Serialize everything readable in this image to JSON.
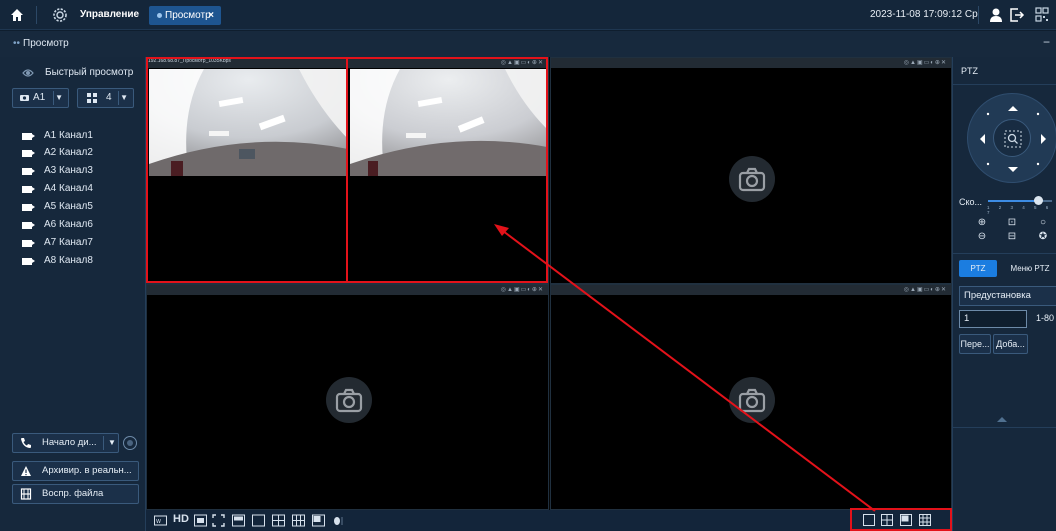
{
  "topbar": {
    "title": "Управление",
    "tab_label": "Просмотр",
    "tab_close": "×",
    "datetime": "2023-11-08 17:09:12 Ср"
  },
  "subbar": {
    "title": "Просмотр",
    "minimize": "−"
  },
  "left_panel": {
    "quick_view": "Быстрый просмотр",
    "stream_select": "A1",
    "split_select": "4",
    "channels": [
      "A1 Канал1",
      "A2 Канал2",
      "A3 Канал3",
      "A4 Канал4",
      "A5 Канал5",
      "A6 Канал6",
      "A7 Канал7",
      "A8 Канал8"
    ],
    "record_button": "Начало ди...",
    "archive_button": "Архивир. в реальн...",
    "playback_button": "Воспр. файла"
  },
  "video": {
    "feed_info": "192.168.68.87_Просмотр_1035Kbps"
  },
  "bottom_toolbar": {
    "hd_label": "HD"
  },
  "right_panel": {
    "ptz_title": "PTZ",
    "speed_label": "Ско...",
    "speed_ticks": "1 2 3 4 5 6 7",
    "speed_level": 6,
    "tab_ptz": "PTZ",
    "tab_menu": "Меню PTZ",
    "preset_select": "Предустановка",
    "preset_number": "1",
    "preset_range": "1-80",
    "goto_button": "Пере...",
    "add_button": "Доба..."
  },
  "colors": {
    "accent": "#1b7de0",
    "annotation": "#e3121a",
    "background": "#0f1e2e"
  }
}
